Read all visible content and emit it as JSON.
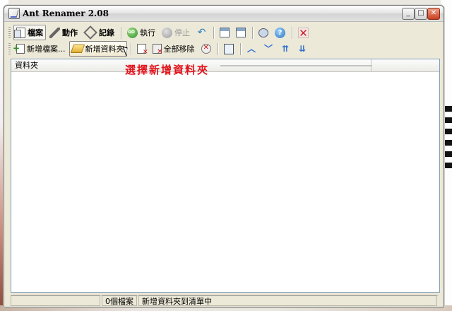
{
  "window": {
    "title": "Ant Renamer 2.08"
  },
  "titlebar_buttons": {
    "minimize": "_",
    "maximize": "□",
    "close": "✕"
  },
  "toolbar_main": {
    "files_label": "檔案",
    "actions_label": "動作",
    "log_label": "記錄",
    "run_label": "執行",
    "stop_label": "停止"
  },
  "toolbar_files": {
    "add_files_label": "新增檔案...",
    "add_folders_label": "新增資料夾",
    "remove_all_label": "全部移除"
  },
  "annotation": {
    "text": "選擇新增資料夾"
  },
  "list": {
    "column_header": "資料夾"
  },
  "status": {
    "panel1": "",
    "file_count": "0個檔案",
    "message": "新增資料夾到清單中"
  },
  "icons": [
    "files-icon",
    "actions-icon",
    "log-icon",
    "go-icon",
    "stop-icon",
    "undo-icon",
    "window-icon",
    "options-icon",
    "bubble-icon",
    "help-icon",
    "exit-icon",
    "add-files-icon",
    "folder-icon",
    "remove-icon",
    "clear-icon",
    "cancel-icon",
    "preview-icon",
    "move-up-icon",
    "move-down-icon",
    "move-top-icon",
    "move-bottom-icon"
  ],
  "colors": {
    "annotation": "#e3131b",
    "titlebar": "#e2e2e2",
    "list_border": "#7f9db9"
  }
}
